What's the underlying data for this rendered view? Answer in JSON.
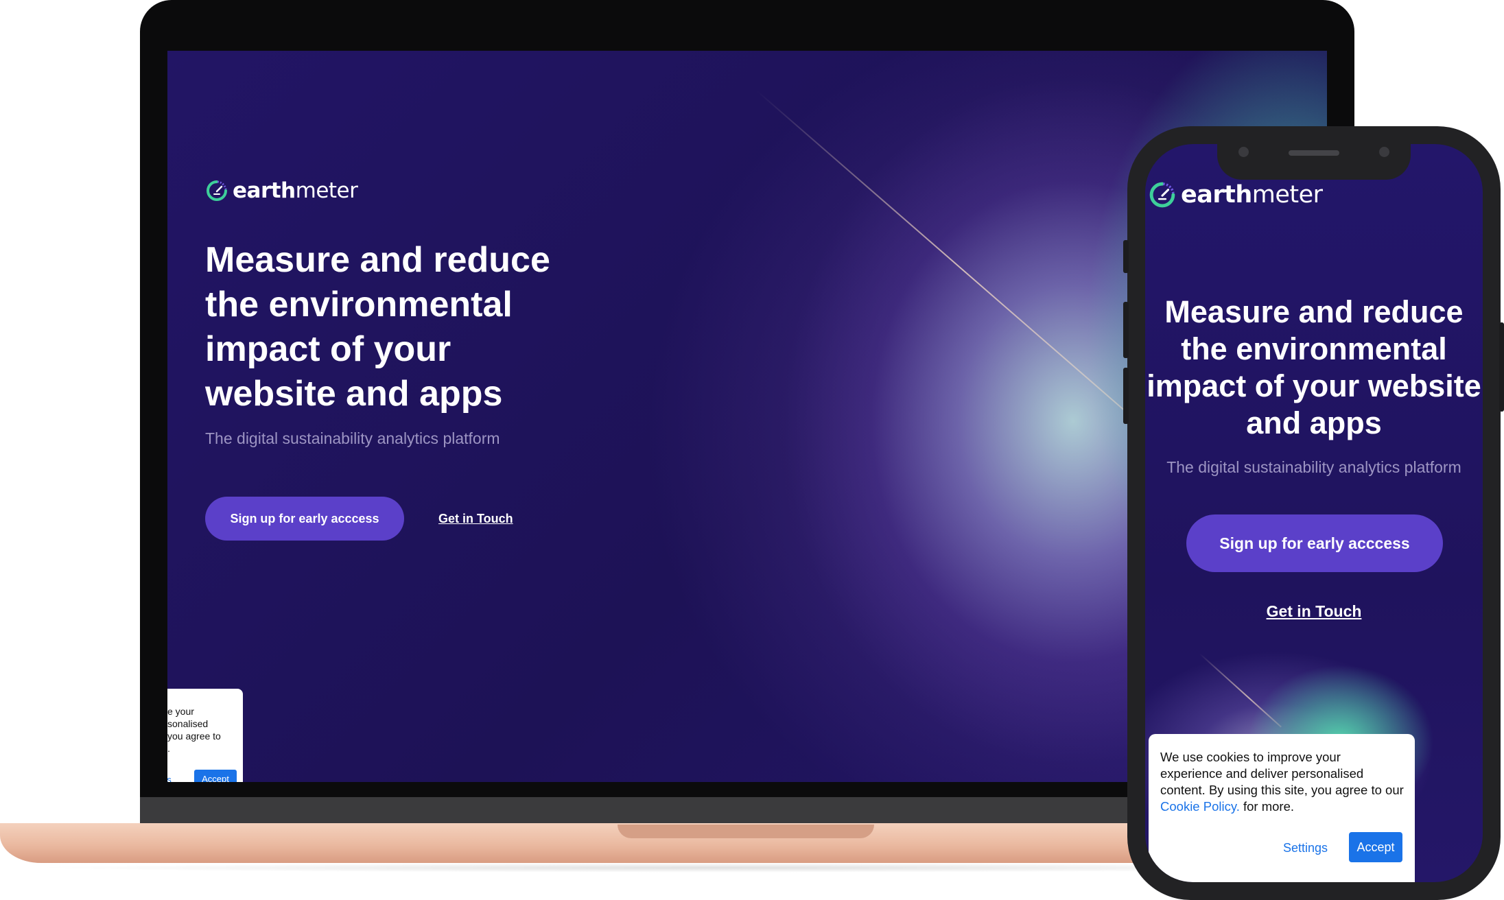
{
  "brand": {
    "name_bold": "earth",
    "name_light": "meter",
    "accent_color": "#5b40c9",
    "logo_colors": [
      "#3ecf9a",
      "#5b40c9"
    ]
  },
  "hero": {
    "headline": "Measure and reduce the environmental impact of your website and apps",
    "subtitle": "The digital sustainability analytics platform",
    "primary_cta": "Sign up for early acccess",
    "secondary_cta": "Get in Touch"
  },
  "laptop_cookie": {
    "lines": [
      "e your",
      "sonalised",
      "you agree to",
      "."
    ],
    "settings_label": "gs",
    "accept_label": "Accept"
  },
  "phone_cookie": {
    "message_before_link": "We use cookies to improve your experience and deliver personalised content. By using this site, you agree to our ",
    "policy_link": "Cookie Policy.",
    "message_after_link": " for more.",
    "settings_label": "Settings",
    "accept_label": "Accept"
  },
  "icons": {
    "logo": "earthmeter-gauge-icon"
  }
}
